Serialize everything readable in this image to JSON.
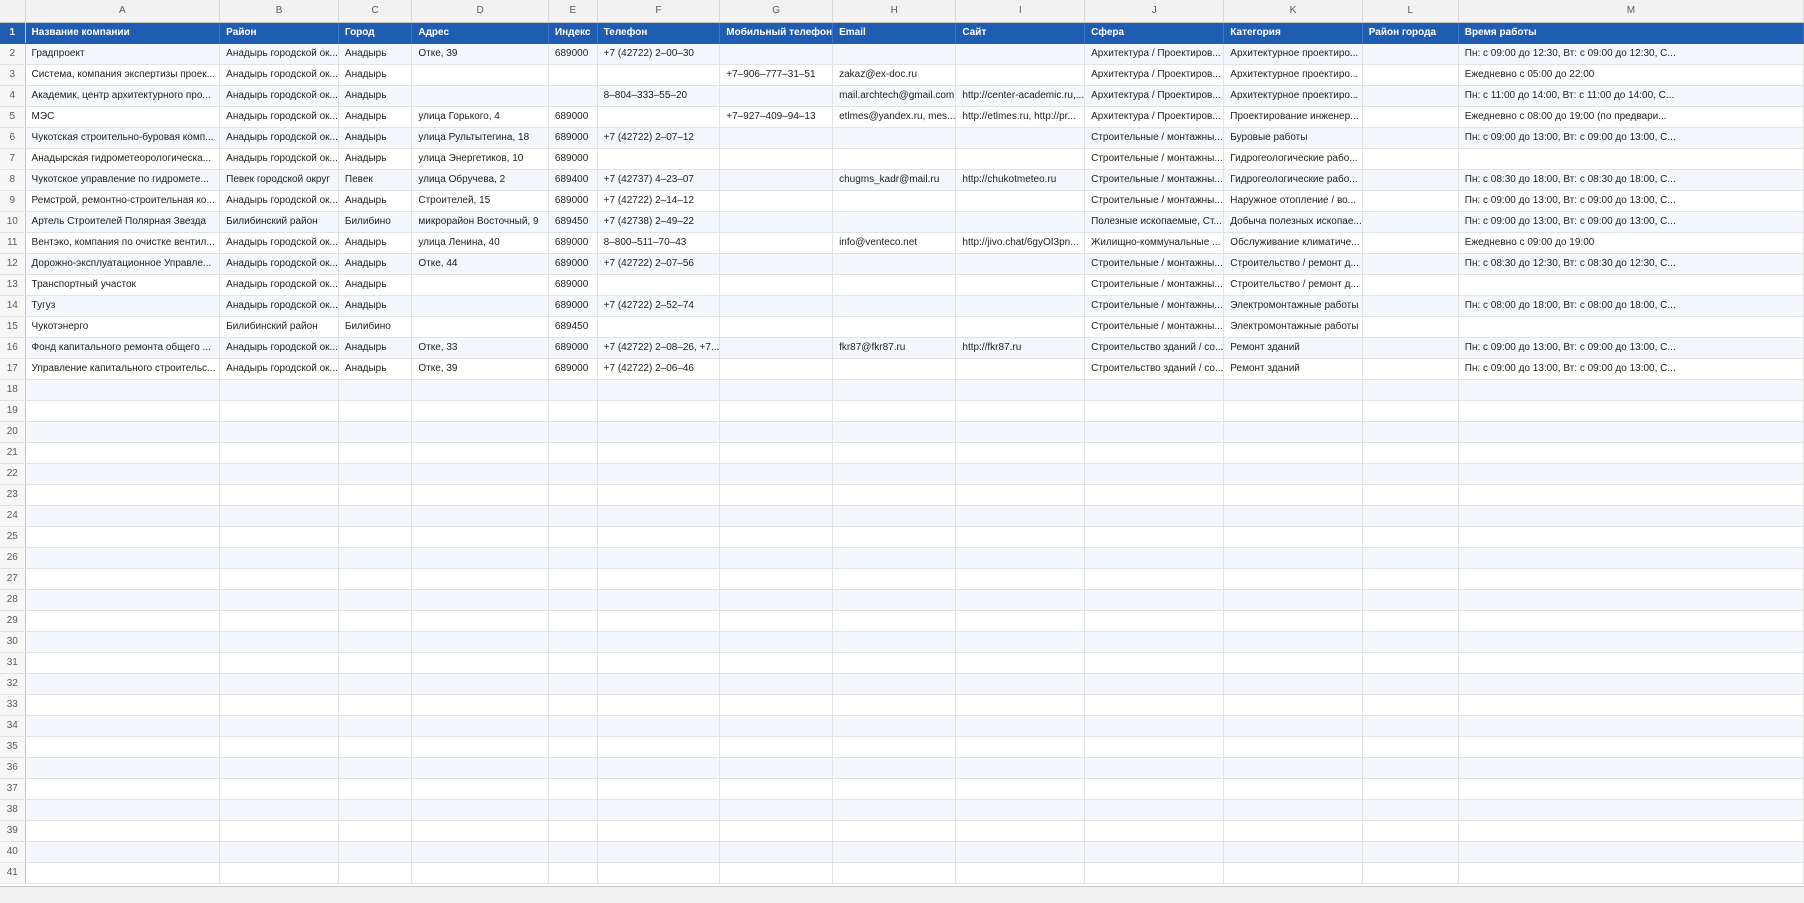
{
  "sheet": {
    "column_letters": [
      "A",
      "B",
      "C",
      "D",
      "E",
      "F",
      "G",
      "H",
      "I",
      "J",
      "K",
      "L",
      "M"
    ],
    "header_row_number": "1",
    "headers": [
      "Название компании",
      "Район",
      "Город",
      "Адрес",
      "Индекс",
      "Телефон",
      "Мобильный телефон",
      "Email",
      "Сайт",
      "Сфера",
      "Категория",
      "Район города",
      "Время работы"
    ],
    "rows": [
      {
        "n": "2",
        "cells": [
          "Градпроект",
          "Анадырь городской ок...",
          "Анадырь",
          "Отке, 39",
          "689000",
          "+7 (42722) 2–00–30",
          "",
          "",
          "",
          "Архитектура / Проектиров...",
          "Архитектурное проектиро...",
          "",
          "Пн: с 09:00 до 12:30, Вт: с 09:00 до 12:30, С..."
        ]
      },
      {
        "n": "3",
        "cells": [
          "Система, компания экспертизы проек...",
          "Анадырь городской ок...",
          "Анадырь",
          "",
          "",
          "",
          "+7–906–777–31–51",
          "zakaz@ex-doc.ru",
          "",
          "Архитектура / Проектиров...",
          "Архитектурное проектиро...",
          "",
          "Ежедневно с 05:00 до 22:00"
        ]
      },
      {
        "n": "4",
        "cells": [
          "Академик, центр архитектурного про...",
          "Анадырь городской ок...",
          "Анадырь",
          "",
          "",
          "8–804–333–55–20",
          "",
          "mail.archtech@gmail.com",
          "http://center-academic.ru,...",
          "Архитектура / Проектиров...",
          "Архитектурное проектиро...",
          "",
          "Пн: с 11:00 до 14:00, Вт: с 11:00 до 14:00, С..."
        ]
      },
      {
        "n": "5",
        "cells": [
          "МЭС",
          "Анадырь городской ок...",
          "Анадырь",
          "улица Горького, 4",
          "689000",
          "",
          "+7–927–409–94–13",
          "etlmes@yandex.ru, mes...",
          "http://etlmes.ru, http://pr...",
          "Архитектура / Проектиров...",
          "Проектирование инженер...",
          "",
          "Ежедневно с 08:00 до 19:00 (по предвари..."
        ]
      },
      {
        "n": "6",
        "cells": [
          "Чукотская строительно-буровая комп...",
          "Анадырь городской ок...",
          "Анадырь",
          "улица Рультытегина, 18",
          "689000",
          "+7 (42722) 2–07–12",
          "",
          "",
          "",
          "Строительные / монтажны...",
          "Буровые работы",
          "",
          "Пн: с 09:00 до 13:00, Вт: с 09:00 до 13:00, С..."
        ]
      },
      {
        "n": "7",
        "cells": [
          "Анадырская гидрометеорологическа...",
          "Анадырь городской ок...",
          "Анадырь",
          "улица Энергетиков, 10",
          "689000",
          "",
          "",
          "",
          "",
          "Строительные / монтажны...",
          "Гидрогеологические рабо...",
          "",
          ""
        ]
      },
      {
        "n": "8",
        "cells": [
          "Чукотское управление по гидромете...",
          "Певек городской округ",
          "Певек",
          "улица Обручева, 2",
          "689400",
          "+7 (42737) 4–23–07",
          "",
          "chugms_kadr@mail.ru",
          "http://chukotmeteo.ru",
          "Строительные / монтажны...",
          "Гидрогеологические рабо...",
          "",
          "Пн: с 08:30 до 18:00, Вт: с 08:30 до 18:00, С..."
        ]
      },
      {
        "n": "9",
        "cells": [
          "Ремстрой, ремонтно-строительная ко...",
          "Анадырь городской ок...",
          "Анадырь",
          "Строителей, 15",
          "689000",
          "+7 (42722) 2–14–12",
          "",
          "",
          "",
          "Строительные / монтажны...",
          "Наружное отопление / во...",
          "",
          "Пн: с 09:00 до 13:00, Вт: с 09:00 до 13:00, С..."
        ]
      },
      {
        "n": "10",
        "cells": [
          "Артель Строителей Полярная Звезда",
          "Билибинский район",
          "Билибино",
          "микрорайон Восточный, 9",
          "689450",
          "+7 (42738) 2–49–22",
          "",
          "",
          "",
          "Полезные ископаемые, Ст...",
          "Добыча полезных ископае...",
          "",
          "Пн: с 09:00 до 13:00, Вт: с 09:00 до 13:00, С..."
        ]
      },
      {
        "n": "11",
        "cells": [
          "Вентэко, компания по очистке вентил...",
          "Анадырь городской ок...",
          "Анадырь",
          "улица Ленина, 40",
          "689000",
          "8–800–511–70–43",
          "",
          "info@venteco.net",
          "http://jivo.chat/6gyOI3pn...",
          "Жилищно-коммунальные ...",
          "Обслуживание климатиче...",
          "",
          "Ежедневно с 09:00 до 19:00"
        ]
      },
      {
        "n": "12",
        "cells": [
          "Дорожно-эксплуатационное Управле...",
          "Анадырь городской ок...",
          "Анадырь",
          "Отке, 44",
          "689000",
          "+7 (42722) 2–07–56",
          "",
          "",
          "",
          "Строительные / монтажны...",
          "Строительство / ремонт д...",
          "",
          "Пн: с 08:30 до 12:30, Вт: с 08:30 до 12:30, С..."
        ]
      },
      {
        "n": "13",
        "cells": [
          "Транспортный участок",
          "Анадырь городской ок...",
          "Анадырь",
          "",
          "689000",
          "",
          "",
          "",
          "",
          "Строительные / монтажны...",
          "Строительство / ремонт д...",
          "",
          ""
        ]
      },
      {
        "n": "14",
        "cells": [
          "Тугуз",
          "Анадырь городской ок...",
          "Анадырь",
          "",
          "689000",
          "+7 (42722) 2–52–74",
          "",
          "",
          "",
          "Строительные / монтажны...",
          "Электромонтажные работы",
          "",
          "Пн: с 08:00 до 18:00, Вт: с 08:00 до 18:00, С..."
        ]
      },
      {
        "n": "15",
        "cells": [
          "Чукотэнерго",
          "Билибинский район",
          "Билибино",
          "",
          "689450",
          "",
          "",
          "",
          "",
          "Строительные / монтажны...",
          "Электромонтажные работы",
          "",
          ""
        ]
      },
      {
        "n": "16",
        "cells": [
          "Фонд капитального ремонта общего ...",
          "Анадырь городской ок...",
          "Анадырь",
          "Отке, 33",
          "689000",
          "+7 (42722) 2–08–26, +7...",
          "",
          "fkr87@fkr87.ru",
          "http://fkr87.ru",
          "Строительство зданий / со...",
          "Ремонт зданий",
          "",
          "Пн: с 09:00 до 13:00, Вт: с 09:00 до 13:00, С..."
        ]
      },
      {
        "n": "17",
        "cells": [
          "Управление капитального строительс...",
          "Анадырь городской ок...",
          "Анадырь",
          "Отке, 39",
          "689000",
          "+7 (42722) 2–06–46",
          "",
          "",
          "",
          "Строительство зданий / со...",
          "Ремонт зданий",
          "",
          "Пн: с 09:00 до 13:00, Вт: с 09:00 до 13:00, С..."
        ]
      }
    ],
    "empty_row_numbers": [
      "18",
      "19",
      "20",
      "21",
      "22",
      "23",
      "24",
      "25",
      "26",
      "27",
      "28",
      "29",
      "30",
      "31",
      "32",
      "33",
      "34",
      "35",
      "36",
      "37",
      "38",
      "39",
      "40",
      "41"
    ]
  }
}
